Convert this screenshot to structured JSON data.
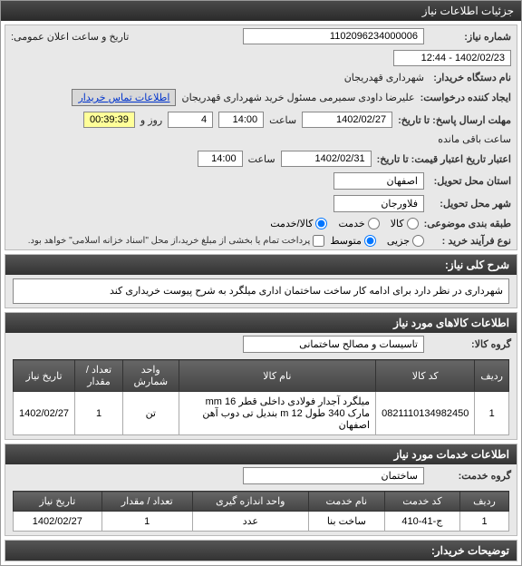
{
  "header": {
    "title": "جزئیات اطلاعات نیاز"
  },
  "main": {
    "niaz_no_label": "شماره نیاز:",
    "niaz_no": "1102096234000006",
    "announce_label": "تاریخ و ساعت اعلان عمومی:",
    "announce_value": "1402/02/23 - 12:44",
    "buyer_org_label": "نام دستگاه خریدار:",
    "buyer_org": "شهرداری قهدریجان",
    "requester_label": "ایجاد کننده درخواست:",
    "requester": "علیرضا داودی سمیرمی مسئول خرید  شهرداری قهدریجان",
    "contact_btn": "اطلاعات تماس خریدار",
    "deadline_label": "مهلت ارسال پاسخ: تا تاریخ:",
    "deadline_date": "1402/02/27",
    "saat_label": "ساعت",
    "deadline_time": "14:00",
    "rooz_label": "روز و",
    "rooz_val": "4",
    "countdown": "00:39:39",
    "remain_label": "ساعت باقی مانده",
    "validity_label": "اعتبار تاریخ اعتبار قیمت: تا تاریخ:",
    "validity_date": "1402/02/31",
    "validity_time": "14:00",
    "prov_buyer_label": "استان محل تحویل:",
    "prov_buyer": "اصفهان",
    "city_label": "شهر محل تحویل:",
    "city": "فلاورجان",
    "class_label": "طبقه بندی موضوعی:",
    "class_opts": {
      "kala": "کالا",
      "khadamat": "خدمت",
      "both": "کالا/خدمت"
    },
    "buy_type_label": "نوع فرآیند خرید :",
    "buy_opts": {
      "jozee": "جزیی",
      "motevaset": "متوسط"
    },
    "pay_note": "پرداخت تمام یا بخشی از مبلغ خرید،از محل \"اسناد خزانه اسلامی\" خواهد بود."
  },
  "overview": {
    "title": "شرح کلی نیاز:",
    "text": "شهرداری در نظر دارد برای ادامه کار ساخت ساختمان اداری میلگرد به شرح پیوست خریداری کند"
  },
  "goods": {
    "title": "اطلاعات کالاهای مورد نیاز",
    "group_label": "گروه کالا:",
    "group_value": "تاسیسات و مصالح ساختمانی",
    "headers": {
      "radif": "ردیف",
      "code": "کد کالا",
      "name": "نام کالا",
      "unit": "واحد شمارش",
      "qty": "تعداد / مقدار",
      "date": "تاریخ نیاز"
    },
    "rows": [
      {
        "radif": "1",
        "code": "0821110134982450",
        "name": "میلگرد آجدار فولادی داخلی قطر 16 mm مارک 340 طول 12 m بندیل تی دوب آهن اصفهان",
        "unit": "تن",
        "qty": "1",
        "date": "1402/02/27"
      }
    ]
  },
  "services": {
    "title": "اطلاعات خدمات مورد نیاز",
    "group_label": "گروه خدمت:",
    "group_value": "ساختمان",
    "headers": {
      "radif": "ردیف",
      "code": "کد خدمت",
      "name": "نام خدمت",
      "unit": "واحد اندازه گیری",
      "qty": "تعداد / مقدار",
      "date": "تاریخ نیاز"
    },
    "rows": [
      {
        "radif": "1",
        "code": "ج-41-410",
        "name": "ساخت بنا",
        "unit": "عدد",
        "qty": "1",
        "date": "1402/02/27"
      }
    ]
  },
  "buyer_notes": {
    "title": "توضیحات خریدار:"
  }
}
